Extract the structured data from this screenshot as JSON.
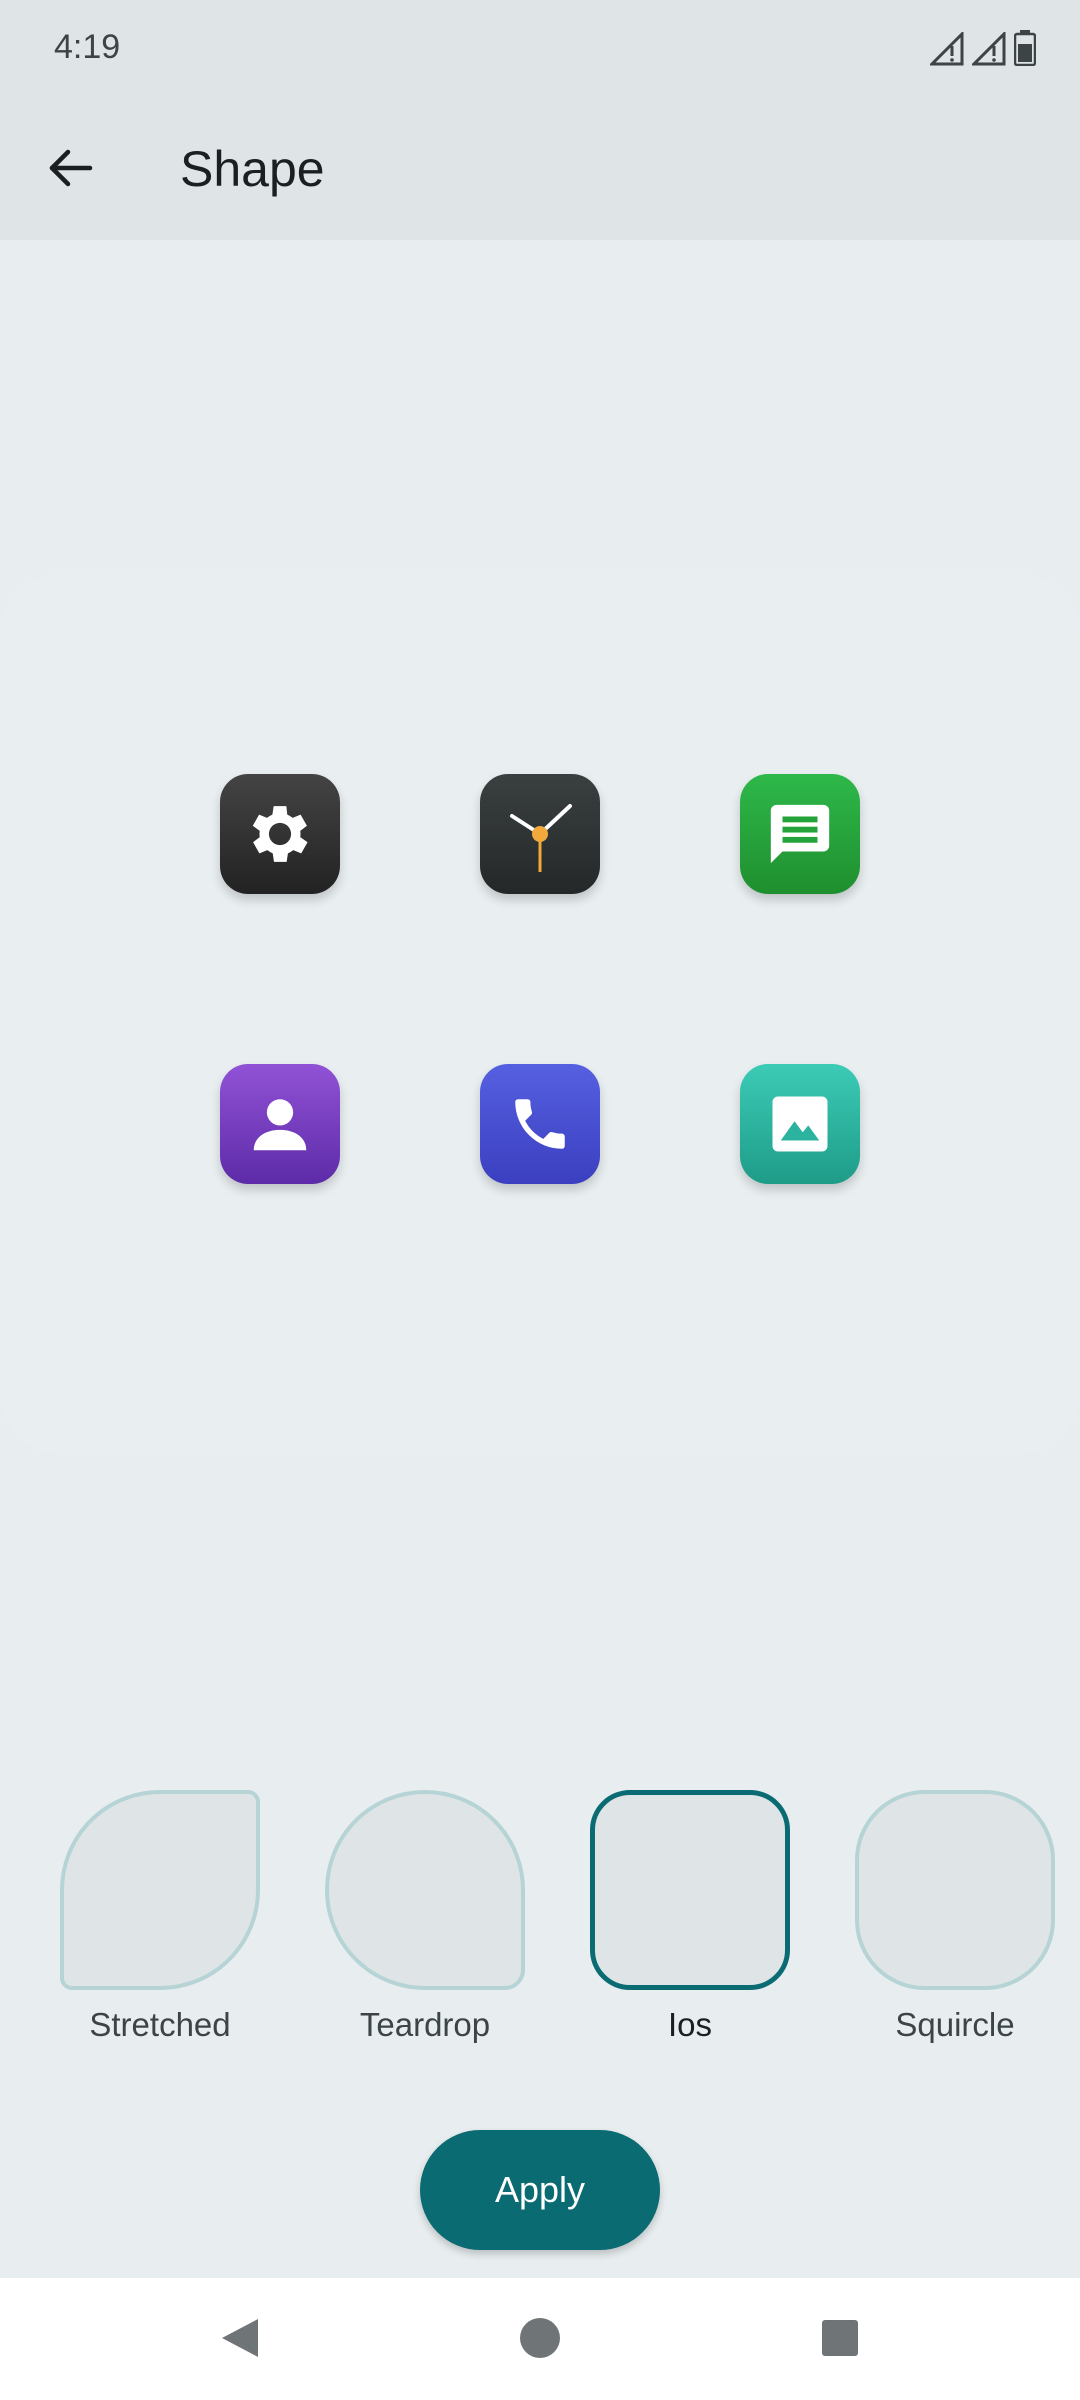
{
  "status_bar": {
    "time": "4:19",
    "icons": [
      "signal-icon",
      "signal-icon",
      "battery-icon"
    ]
  },
  "app_bar": {
    "back_icon": "arrow-left-icon",
    "title": "Shape"
  },
  "preview": {
    "apps": [
      {
        "icon": "settings-icon",
        "color": "#333333"
      },
      {
        "icon": "clock-icon",
        "color": "#2b2f30"
      },
      {
        "icon": "messages-icon",
        "color": "#23a33a"
      },
      {
        "icon": "contacts-icon",
        "color": "#7a42c3"
      },
      {
        "icon": "phone-icon",
        "color": "#4a52d4"
      },
      {
        "icon": "gallery-icon",
        "color": "#2cb3a0"
      }
    ]
  },
  "shapes": {
    "options": [
      {
        "label": "Stretched",
        "selected": false
      },
      {
        "label": "Teardrop",
        "selected": false
      },
      {
        "label": "Ios",
        "selected": true
      },
      {
        "label": "Squircle",
        "selected": false
      }
    ]
  },
  "actions": {
    "apply_label": "Apply"
  },
  "colors": {
    "accent": "#0b6b73",
    "shape_border": "#b6d3d6",
    "background": "#e8eef0"
  },
  "nav_bar": {
    "buttons": [
      "back-triangle-icon",
      "home-circle-icon",
      "recents-square-icon"
    ]
  }
}
